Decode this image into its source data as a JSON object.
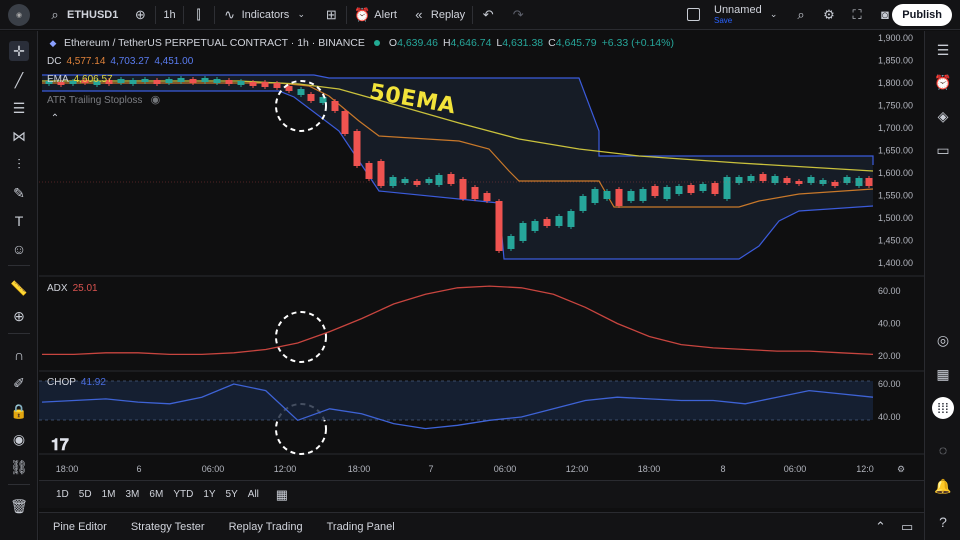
{
  "topbar": {
    "symbol": "ETHUSD1",
    "interval": "1h",
    "indicators_label": "Indicators",
    "alert_label": "Alert",
    "replay_label": "Replay",
    "layout_name": "Unnamed",
    "layout_status": "Save",
    "publish_label": "Publish"
  },
  "chart": {
    "title": "Ethereum / TetherUS PERPETUAL CONTRACT · 1h · BINANCE",
    "ohlc": {
      "o_key": "O",
      "o": "4,639.46",
      "h_key": "H",
      "h": "4,646.74",
      "l_key": "L",
      "l": "4,631.38",
      "c_key": "C",
      "c": "4,645.79",
      "chg": "+6.33 (+0.14%)"
    },
    "dc": {
      "label": "DC",
      "v1": "4,577.14",
      "v2": "4,703.27",
      "v3": "4,451.00"
    },
    "ema": {
      "label": "EMA",
      "v": "4,606.57"
    },
    "atr_label": "ATR Trailing Stoploss",
    "annotation": "50EMA",
    "price_ticks": [
      "1,900.00",
      "1,850.00",
      "1,800.00",
      "1,750.00",
      "1,700.00",
      "1,650.00",
      "1,600.00",
      "1,550.00",
      "1,500.00",
      "1,450.00",
      "1,400.00"
    ],
    "adx": {
      "label": "ADX",
      "value": "25.01",
      "ticks": [
        "60.00",
        "40.00",
        "20.00"
      ]
    },
    "chop": {
      "label": "CHOP",
      "value": "41.92",
      "ticks": [
        "60.00",
        "40.00"
      ]
    },
    "time_ticks": [
      "18:00",
      "6",
      "06:00",
      "12:00",
      "18:00",
      "7",
      "06:00",
      "12:00",
      "18:00",
      "8",
      "06:00",
      "12:0"
    ]
  },
  "chart_data": [
    {
      "type": "line",
      "title": "",
      "series": [
        {
          "name": "ADX",
          "values": [
            21,
            21,
            22,
            22,
            21,
            21,
            22,
            24,
            28,
            35,
            43,
            52,
            58,
            62,
            63,
            62,
            58,
            50,
            40,
            32,
            27,
            25,
            24,
            23,
            23,
            22,
            21
          ]
        }
      ],
      "ylim": [
        15,
        65
      ]
    },
    {
      "type": "line",
      "title": "",
      "series": [
        {
          "name": "CHOP",
          "values": [
            49,
            50,
            51,
            49,
            48,
            52,
            60,
            56,
            38,
            45,
            42,
            36,
            33,
            35,
            38,
            40,
            45,
            50,
            52,
            51,
            50,
            50,
            48,
            52,
            56,
            54,
            52
          ]
        }
      ],
      "ylim": [
        30,
        65
      ]
    }
  ],
  "rangebar": [
    "1D",
    "5D",
    "1M",
    "3M",
    "6M",
    "YTD",
    "1Y",
    "5Y",
    "All"
  ],
  "bottom_tabs": [
    "Pine Editor",
    "Strategy Tester",
    "Replay Trading",
    "Trading Panel"
  ],
  "colors": {
    "bull": "#26a69a",
    "bear": "#ef5350",
    "dc_band": "#3b5bdb",
    "dc_mid": "#c8782a",
    "ema": "#c9c13c",
    "adx": "#c8453f",
    "chop": "#3e63d6"
  }
}
